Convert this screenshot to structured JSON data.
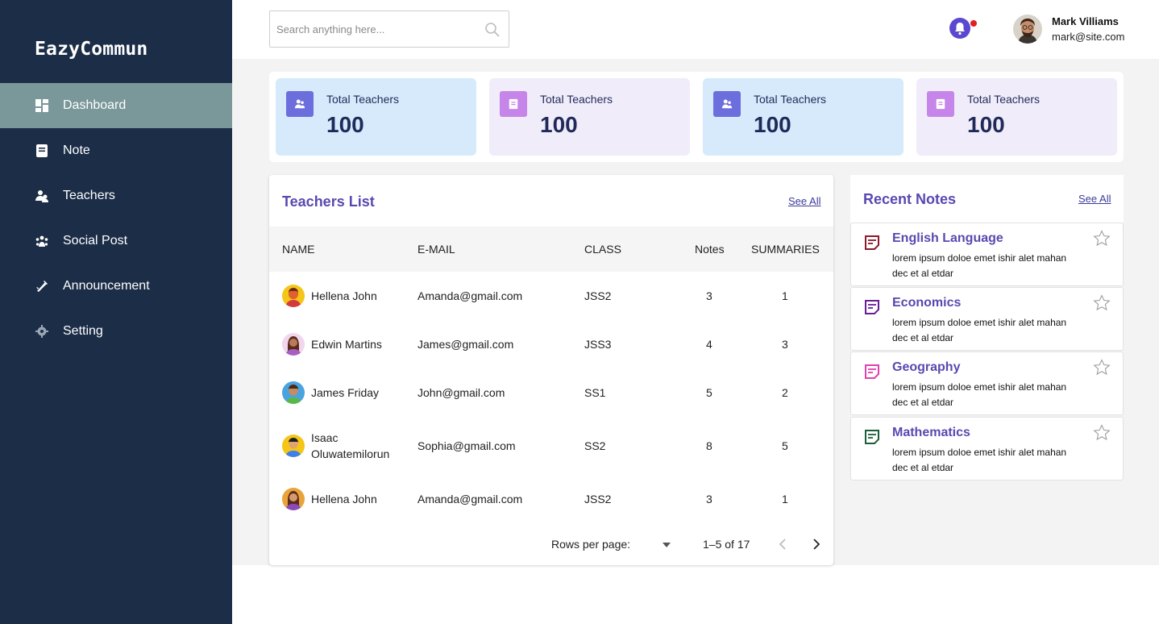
{
  "app": {
    "brand": "EazyCommun"
  },
  "sidebar": {
    "items": [
      {
        "label": "Dashboard",
        "icon": "dashboard-icon",
        "active": true
      },
      {
        "label": "Note",
        "icon": "note-icon"
      },
      {
        "label": "Teachers",
        "icon": "teachers-icon"
      },
      {
        "label": "Social Post",
        "icon": "social-post-icon"
      },
      {
        "label": "Announcement",
        "icon": "announcement-icon"
      },
      {
        "label": "Setting",
        "icon": "gear-icon"
      }
    ]
  },
  "header": {
    "search_placeholder": "Search anything here...",
    "user": {
      "name": "Mark Villiams",
      "email": "mark@site.com"
    }
  },
  "stats": [
    {
      "label": "Total Teachers",
      "value": "100",
      "icon": "users-icon",
      "color": "blue"
    },
    {
      "label": "Total Teachers",
      "value": "100",
      "icon": "note-icon",
      "color": "purple"
    },
    {
      "label": "Total Teachers",
      "value": "100",
      "icon": "users-icon",
      "color": "blue"
    },
    {
      "label": "Total Teachers",
      "value": "100",
      "icon": "note-icon",
      "color": "purple"
    }
  ],
  "teachers": {
    "title": "Teachers List",
    "see_all": "See All",
    "columns": [
      "NAME",
      "E-MAIL",
      "CLASS",
      "Notes",
      "SUMMARIES"
    ],
    "rows": [
      {
        "name": "Hellena John",
        "email": "Amanda@gmail.com",
        "class": "JSS2",
        "notes": "3",
        "summaries": "1"
      },
      {
        "name": "Edwin Martins",
        "email": "James@gmail.com",
        "class": "JSS3",
        "notes": "4",
        "summaries": "3"
      },
      {
        "name": "James Friday",
        "email": "John@gmail.com",
        "class": "SS1",
        "notes": "5",
        "summaries": "2"
      },
      {
        "name_line1": "Isaac",
        "name_line2": "Oluwatemilorun",
        "email": "Sophia@gmail.com",
        "class": "SS2",
        "notes": "8",
        "summaries": "5"
      },
      {
        "name": "Hellena John",
        "email": "Amanda@gmail.com",
        "class": "JSS2",
        "notes": "3",
        "summaries": "1"
      }
    ],
    "pagination": {
      "rows_per_page_label": "Rows per page:",
      "range": "1–5 of 17"
    }
  },
  "recent_notes": {
    "title": "Recent Notes",
    "see_all": "See All",
    "items": [
      {
        "title": "English Language",
        "body": "lorem ipsum doloe emet ishir alet mahan dec et al etdar",
        "icon_color": "#8b1a2b"
      },
      {
        "title": "Economics",
        "body": "lorem ipsum doloe emet ishir alet mahan dec et al etdar",
        "icon_color": "#6a1b9a"
      },
      {
        "title": "Geography",
        "body": "lorem ipsum doloe emet ishir alet mahan dec et al etdar",
        "icon_color": "#e040b0"
      },
      {
        "title": "Mathematics",
        "body": "lorem ipsum doloe emet ishir alet mahan dec et al etdar",
        "icon_color": "#1b5e3b"
      }
    ]
  },
  "colors": {
    "sidebar_bg": "#1b2d47",
    "active_nav": "#7a9799",
    "accent": "#5a48b0",
    "stat_blue": "#d6eafb",
    "stat_purple": "#f1ecfa",
    "notification_dot": "#e02020"
  }
}
